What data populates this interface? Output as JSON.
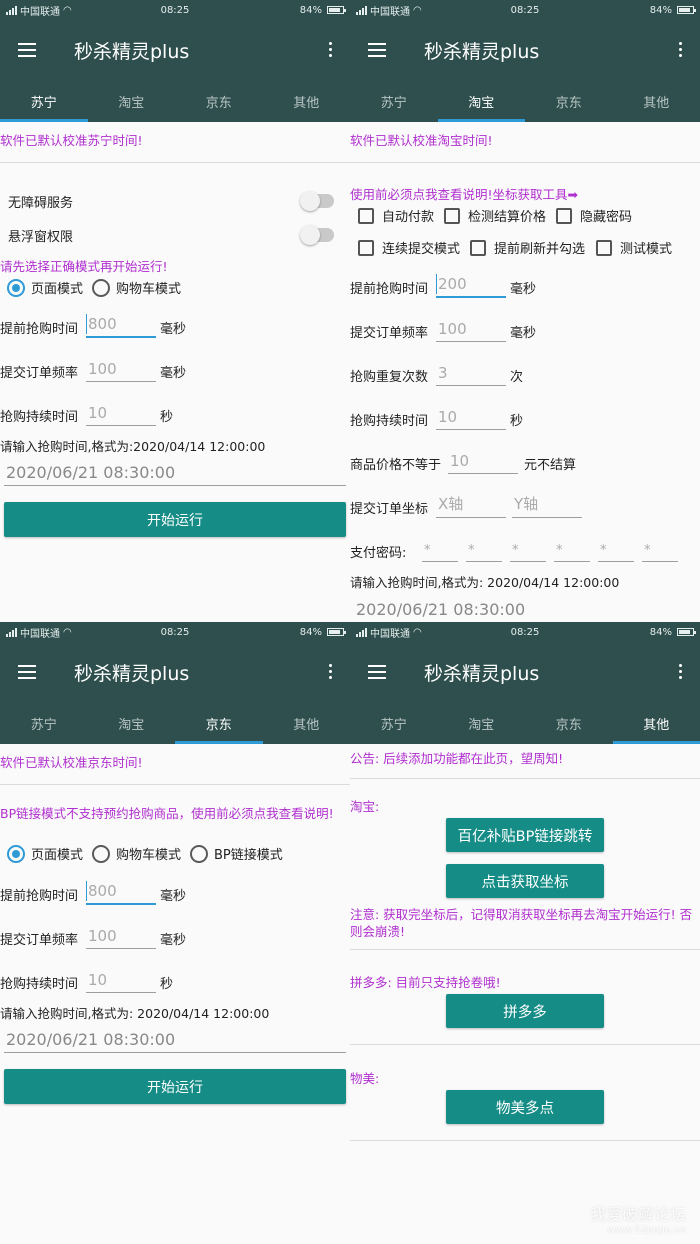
{
  "status": {
    "carrier": "中国联通",
    "time": "08:25",
    "battery": "84%",
    "battery_level": 0.84
  },
  "app_title": "秒杀精灵plus",
  "tabs": [
    "苏宁",
    "淘宝",
    "京东",
    "其他"
  ],
  "p0": {
    "notice": "软件已默认校准苏宁时间!",
    "accessibility": "无障碍服务",
    "float_perm": "悬浮窗权限",
    "select_mode": "请先选择正确模式再开始运行!",
    "mode_page": "页面模式",
    "mode_cart": "购物车模式",
    "advance_label": "提前抢购时间",
    "advance_value": "800",
    "unit_ms": "毫秒",
    "freq_label": "提交订单频率",
    "freq_value": "100",
    "duration_label": "抢购持续时间",
    "duration_value": "10",
    "unit_s": "秒",
    "time_prompt": "请输入抢购时间,格式为:2020/04/14 12:00:00",
    "time_value": "2020/06/21 08:30:00",
    "start": "开始运行"
  },
  "p1": {
    "notice": "软件已默认校准淘宝时间!",
    "readme": "使用前必须点我查看说明!坐标获取工具➡",
    "chk_autopay": "自动付款",
    "chk_check_price": "检测结算价格",
    "chk_hide_pwd": "隐藏密码",
    "chk_continuous": "连续提交模式",
    "chk_refresh": "提前刷新并勾选",
    "chk_test": "测试模式",
    "advance_label": "提前抢购时间",
    "advance_value": "200",
    "unit_ms": "毫秒",
    "freq_label": "提交订单频率",
    "freq_value": "100",
    "repeat_label": "抢购重复次数",
    "repeat_value": "3",
    "unit_times": "次",
    "duration_label": "抢购持续时间",
    "duration_value": "10",
    "unit_s": "秒",
    "price_label": "商品价格不等于",
    "price_value": "10",
    "price_suffix": "元不结算",
    "coord_label": "提交订单坐标",
    "x_placeholder": "X轴",
    "y_placeholder": "Y轴",
    "pwd_label": "支付密码:",
    "pwd_placeholder": "*",
    "time_prompt": "请输入抢购时间,格式为: 2020/04/14 12:00:00",
    "time_value": "2020/06/21 08:30:00"
  },
  "p2": {
    "notice": "软件已默认校准京东时间!",
    "bp_notice": "BP链接模式不支持预约抢购商品，使用前必须点我查看说明!",
    "mode_page": "页面模式",
    "mode_cart": "购物车模式",
    "mode_bp": "BP链接模式",
    "advance_label": "提前抢购时间",
    "advance_value": "800",
    "unit_ms": "毫秒",
    "freq_label": "提交订单频率",
    "freq_value": "100",
    "duration_label": "抢购持续时间",
    "duration_value": "10",
    "unit_s": "秒",
    "time_prompt": "请输入抢购时间,格式为: 2020/04/14 12:00:00",
    "time_value": "2020/06/21 08:30:00",
    "start": "开始运行"
  },
  "p3": {
    "announcement": "公告: 后续添加功能都在此页，望周知!",
    "taobao_label": "淘宝:",
    "btn_bp_jump": "百亿补贴BP链接跳转",
    "btn_get_coord": "点击获取坐标",
    "coord_warning": "注意: 获取完坐标后，记得取消获取坐标再去淘宝开始运行! 否则会崩溃!",
    "pdd_label": "拼多多: 目前只支持抢卷哦!",
    "btn_pdd": "拼多多",
    "wumei_label": "物美:",
    "btn_wumei": "物美多点"
  },
  "watermark": {
    "line1": "我爱破解论坛",
    "line2": "www.52pojie.cn"
  }
}
